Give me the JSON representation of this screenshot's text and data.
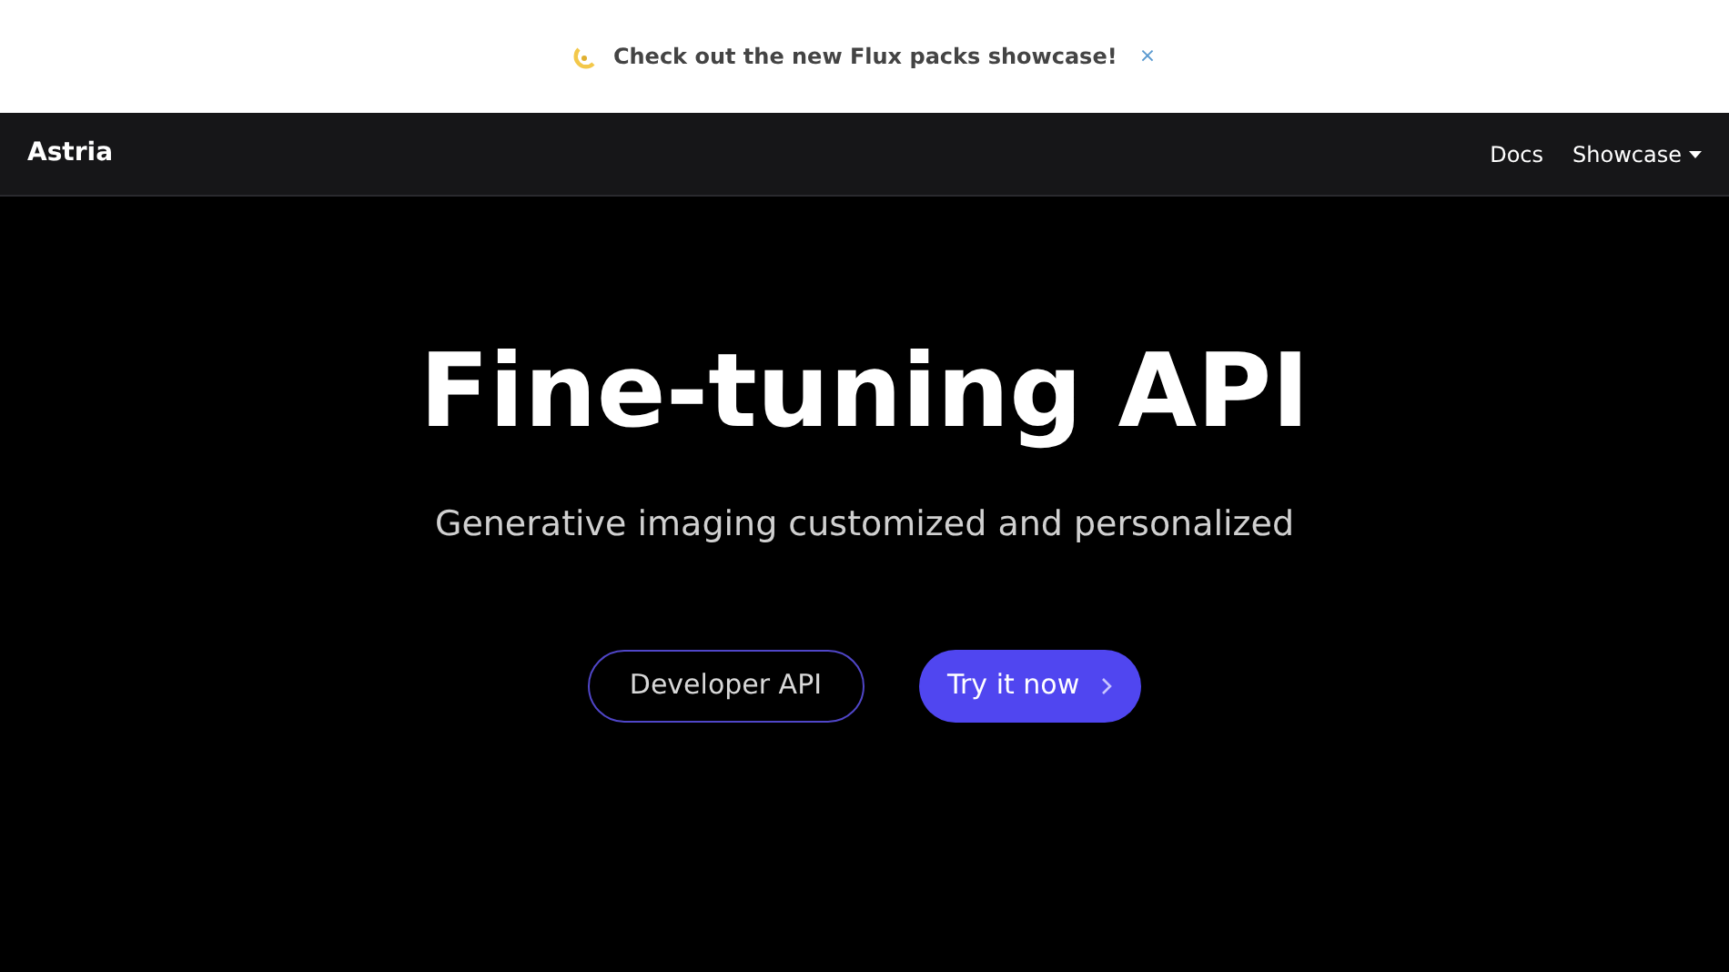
{
  "announcement": {
    "text": "Check out the new Flux packs showcase!",
    "close": "×"
  },
  "navbar": {
    "brand": "Astria",
    "links": [
      {
        "label": "Docs",
        "kind": "link"
      },
      {
        "label": "Showcase",
        "kind": "dropdown"
      }
    ]
  },
  "hero": {
    "title": "Fine-tuning API",
    "subtitle": "Generative imaging customized and personalized",
    "buttons": [
      {
        "label": "Developer API",
        "kind": "outline"
      },
      {
        "label": "Try it now",
        "kind": "primary"
      }
    ]
  }
}
